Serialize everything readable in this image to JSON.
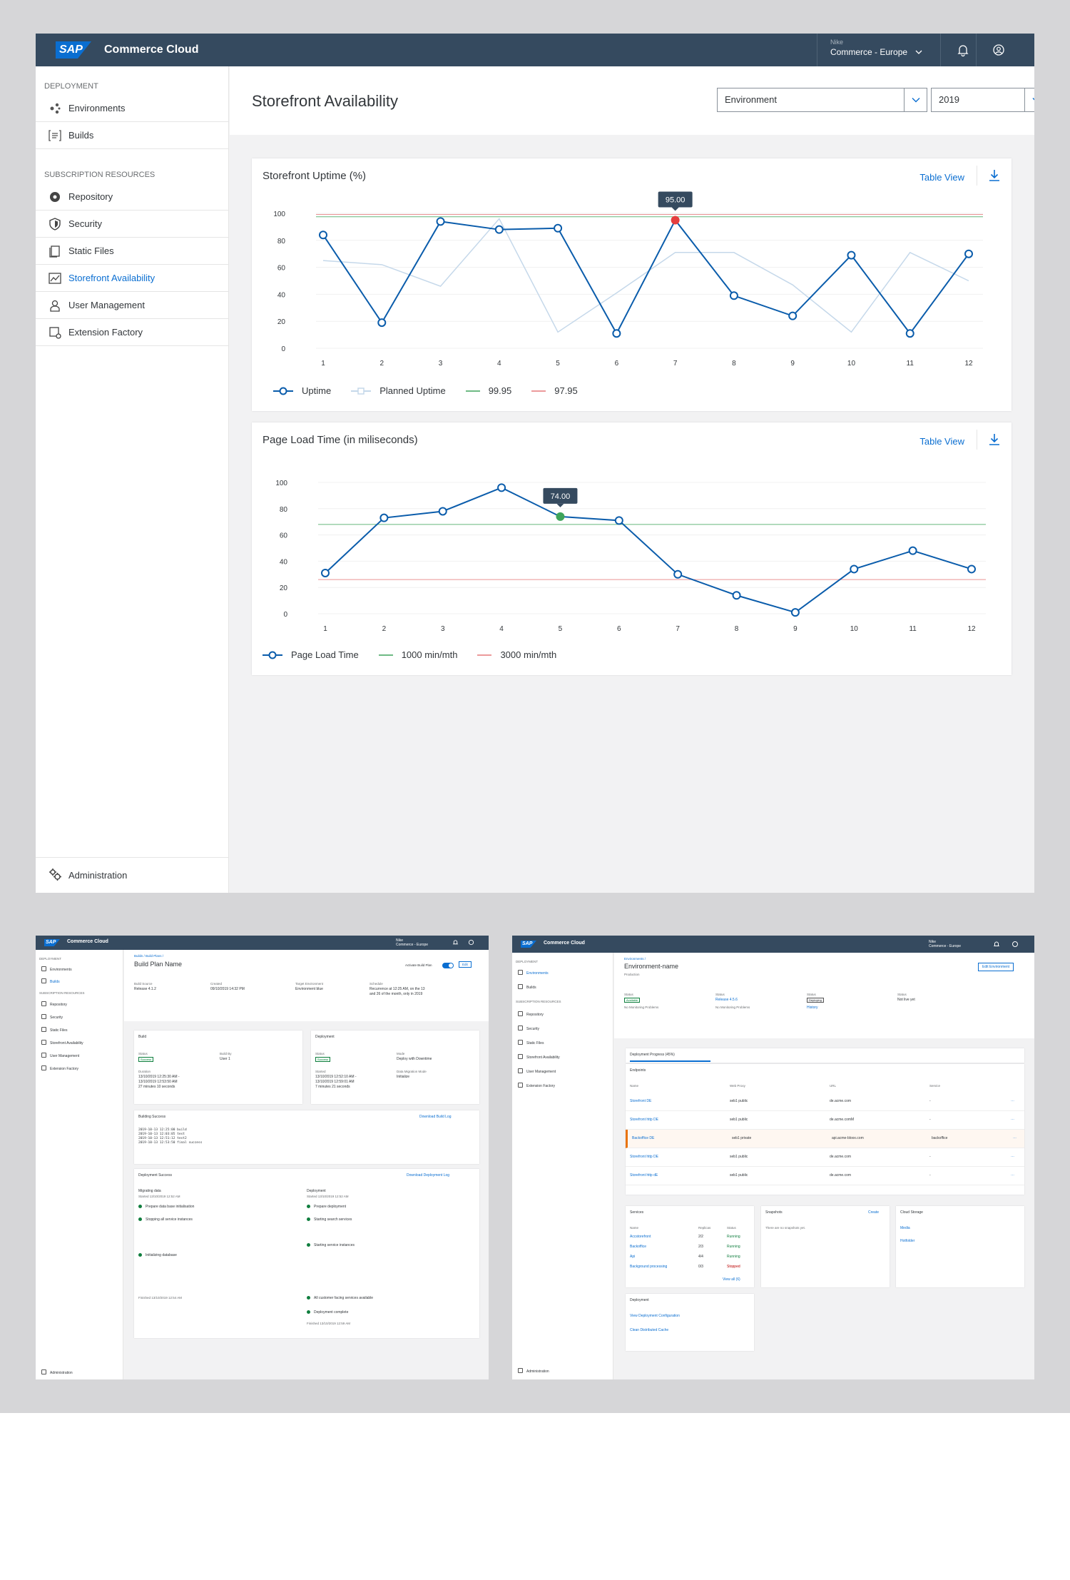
{
  "shell": {
    "logo": "SAP",
    "title": "Commerce Cloud",
    "account_small": "Nike",
    "account_main": "Commerce - Europe"
  },
  "sidebar": {
    "group1": "Deployment",
    "group2": "Subscription Resources",
    "items": [
      {
        "label": "Environments",
        "icon": "environments-icon"
      },
      {
        "label": "Builds",
        "icon": "builds-icon"
      },
      {
        "label": "Repository",
        "icon": "repository-icon"
      },
      {
        "label": "Security",
        "icon": "shield-icon"
      },
      {
        "label": "Static Files",
        "icon": "files-icon"
      },
      {
        "label": "Storefront Availability",
        "icon": "chart-icon"
      },
      {
        "label": "User Management",
        "icon": "user-icon"
      },
      {
        "label": "Extension Factory",
        "icon": "extension-icon"
      }
    ],
    "admin": "Administration"
  },
  "page": {
    "title": "Storefront Availability",
    "environment_select": "Environment",
    "year_select": "2019"
  },
  "charts": {
    "table_view": "Table View"
  },
  "chart_data": [
    {
      "type": "line",
      "title": "Storefront Uptime (%)",
      "x": [
        1,
        2,
        3,
        4,
        5,
        6,
        7,
        8,
        9,
        10,
        11,
        12
      ],
      "ylim": [
        0,
        100
      ],
      "yticks": [
        0,
        20,
        40,
        60,
        80,
        100
      ],
      "series": [
        {
          "name": "Uptime",
          "values": [
            84,
            19,
            94,
            88,
            89,
            11,
            95,
            39,
            24,
            69,
            11,
            70
          ],
          "color": "#0a5cab"
        },
        {
          "name": "Planned Uptime",
          "values": [
            65,
            62,
            46,
            96,
            12,
            41,
            71,
            71,
            47,
            12,
            71,
            50
          ],
          "color": "#c5d8ea"
        }
      ],
      "reference_lines": [
        {
          "name": "99.95",
          "value": 97.5,
          "color": "#3fa45b"
        },
        {
          "name": "97.95",
          "value": 99.2,
          "color": "#e5797a"
        }
      ],
      "tooltip": {
        "x": 7,
        "label": "95.00"
      }
    },
    {
      "type": "line",
      "title": "Page Load Time (in miliseconds)",
      "x": [
        1,
        2,
        3,
        4,
        5,
        6,
        7,
        8,
        9,
        10,
        11,
        12
      ],
      "ylim": [
        0,
        100
      ],
      "yticks": [
        0,
        20,
        40,
        60,
        80,
        100
      ],
      "series": [
        {
          "name": "Page Load Time",
          "values": [
            31,
            73,
            78,
            96,
            74,
            71,
            30,
            14,
            1,
            34,
            48,
            34
          ],
          "color": "#0a5cab"
        }
      ],
      "reference_lines": [
        {
          "name": "1000 min/mth",
          "value": 68,
          "color": "#3fa45b"
        },
        {
          "name": "3000 min/mth",
          "value": 26,
          "color": "#e5797a"
        }
      ],
      "tooltip": {
        "x": 5,
        "label": "74.00"
      }
    }
  ],
  "thumb_build": {
    "breadcrumb": "Builds  /  Build Plans  /",
    "title": "Build Plan Name",
    "activate": "Activate Build Plan",
    "edit": "Edit",
    "meta": [
      {
        "label": "Build Source",
        "value": "Release 4.1.2"
      },
      {
        "label": "Created",
        "value": "09/10/2019 14:32 PM"
      },
      {
        "label": "Target Environment",
        "value": "Environment blue"
      },
      {
        "label": "Schedule",
        "value": "Recurrence at 12:25 AM, on the 13\nand 26 of the month, only in 2019"
      }
    ],
    "build_card": {
      "title": "Build",
      "status_label": "Status",
      "status": "Success",
      "by_label": "Build By",
      "by": "User 1",
      "duration_label": "Duration",
      "duration": "13/10/2019 12:25:30 AM -\n13/10/2019 12:53:50 AM\n27 minutes 10 seconds"
    },
    "deploy_card": {
      "title": "Deployment",
      "status_label": "Status",
      "status": "Success",
      "mode_label": "Mode",
      "mode": "Deploy with Downtime",
      "started_label": "Started",
      "started": "13/10/2019 12:52:10 AM -\n13/10/2019 12:59:01 AM\n7 minutes 21 seconds",
      "migration_label": "Data Migration Mode",
      "migration": "Initialize"
    },
    "log_title": "Building Success",
    "log_link": "Download Build Log",
    "log_text": "2019-10-13 12:25:00 build\n2019-10-13 12:03:05 test\n2019-10-13 12:51:12 test2\n2019-10-13 12:53:50 final success",
    "deploy_title": "Deployment Success",
    "deploy_link": "Download Deployment Log",
    "migrating": "Migrating data",
    "migrating_started": "Started 13/10/2019 12:52 AM",
    "deployment": "Deployment",
    "deployment_started": "Started 13/10/2019 12:52 AM",
    "left_steps": [
      "Prepare data base initialisation",
      "Stopping all service instances",
      "Initializing database"
    ],
    "right_steps": [
      "Prepare deployment",
      "Starting search services",
      "Starting service instances",
      "All customer facing services available",
      "Deployment complete"
    ],
    "left_finished": "Finished 13/10/2019 12:54 AM",
    "right_finished": "Finished 13/10/2019 12:59 AM",
    "admin": "Administration"
  },
  "thumb_env": {
    "breadcrumb": "Environments  /",
    "title": "Environment-name",
    "subtitle": "Production",
    "edit": "Edit Environment",
    "status_label": "Status",
    "status_value": "Available",
    "deploy_status": "Release 4.5.6",
    "deploy_status_label": "Status",
    "deploying": "Deploying",
    "history": "History",
    "not_live": "Not live yet",
    "no_monitor": "No Monitoring Problems",
    "progress": "Deployment Progress (45%)",
    "progress_value": 0.45,
    "endpoints_title": "Endpoints",
    "endpoint_headers": [
      "Name",
      "Web Proxy",
      "URL",
      "Service"
    ],
    "endpoints": [
      {
        "name": "Storefront DE",
        "proxy": "seb1 public",
        "url": "de.acme.com",
        "service": "-"
      },
      {
        "name": "Storefront http DE",
        "proxy": "seb1 public",
        "url": "de.acme.comM",
        "service": "-"
      },
      {
        "name": "Backoffice DE",
        "proxy": "seb1 private",
        "url": "api.acme-bloox.com",
        "service": "backoffice"
      },
      {
        "name": "Storefront http DE",
        "proxy": "seb1 public",
        "url": "de.acme.com",
        "service": "-"
      },
      {
        "name": "Storefront http dE",
        "proxy": "seb1 public",
        "url": "de.acme.com",
        "service": "-"
      }
    ],
    "services_title": "Services",
    "services_headers": [
      "Name",
      "Replicas",
      "Status"
    ],
    "services": [
      {
        "name": "Accstorefront",
        "replicas": "2/2",
        "status": "Running"
      },
      {
        "name": "Backoffice",
        "replicas": "2/3",
        "status": "Running"
      },
      {
        "name": "Api",
        "replicas": "4/4",
        "status": "Running"
      },
      {
        "name": "Background processing",
        "replicas": "0/3",
        "status": "Stopped"
      }
    ],
    "view_all": "View all (6)",
    "snapshots_title": "Snapshots",
    "snapshots_create": "Create",
    "snapshots_empty": "There are no snapshots yet.",
    "cloud_title": "Cloud Storage",
    "cloud_items": [
      "Media",
      "Hotfolder"
    ],
    "deployment_title": "Deployment",
    "deployment_links": [
      "View Deployment Configuration",
      "Clean Distributed Cache"
    ],
    "admin": "Administration"
  }
}
